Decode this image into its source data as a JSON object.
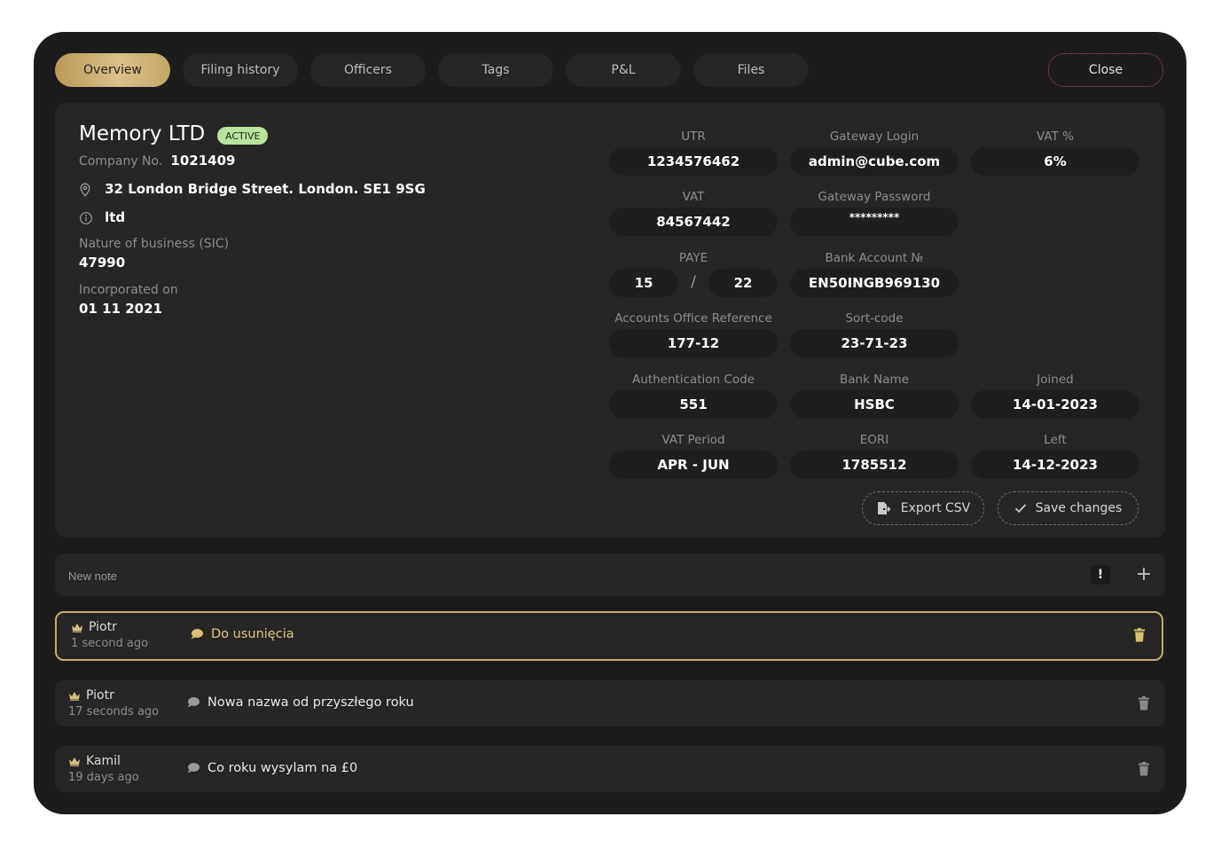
{
  "tabs": [
    {
      "label": "Overview",
      "active": true
    },
    {
      "label": "Filing history",
      "active": false
    },
    {
      "label": "Officers",
      "active": false
    },
    {
      "label": "Tags",
      "active": false
    },
    {
      "label": "P&L",
      "active": false
    },
    {
      "label": "Files",
      "active": false
    }
  ],
  "close_label": "Close",
  "company": {
    "name": "Memory LTD",
    "status": "ACTIVE",
    "number_label": "Company No.",
    "number": "1021409",
    "address": "32 London Bridge Street.  London. SE1 9SG",
    "type": "ltd",
    "sic_label": "Nature of business (SIC)",
    "sic": "47990",
    "incorporated_label": "Incorporated on",
    "incorporated": "01 11 2021"
  },
  "fields": {
    "utr": {
      "label": "UTR",
      "value": "1234576462"
    },
    "gateway_login": {
      "label": "Gateway Login",
      "value": "admin@cube.com"
    },
    "vat_percent": {
      "label": "VAT %",
      "value": "6%"
    },
    "vat": {
      "label": "VAT",
      "value": "84567442"
    },
    "gateway_password": {
      "label": "Gateway Password",
      "value": "*********"
    },
    "paye": {
      "label": "PAYE",
      "value_a": "15",
      "separator": "/",
      "value_b": "22"
    },
    "bank_account": {
      "label": "Bank Account №",
      "value": "EN50INGB969130"
    },
    "accounts_office_ref": {
      "label": "Accounts Office Reference",
      "value": "177-12"
    },
    "sort_code": {
      "label": "Sort-code",
      "value": "23-71-23"
    },
    "auth_code": {
      "label": "Authentication Code",
      "value": "551"
    },
    "bank_name": {
      "label": "Bank Name",
      "value": "HSBC"
    },
    "joined": {
      "label": "Joined",
      "value": "14-01-2023"
    },
    "vat_period": {
      "label": "VAT Period",
      "value": "APR - JUN"
    },
    "eori": {
      "label": "EORI",
      "value": "1785512"
    },
    "left": {
      "label": "Left",
      "value": "14-12-2023"
    }
  },
  "actions": {
    "export_label": "Export CSV",
    "save_label": "Save changes"
  },
  "note_input": {
    "placeholder": "New note",
    "important_label": "!",
    "add_label": "+"
  },
  "notes": [
    {
      "author": "Piotr",
      "time": "1 second ago",
      "text": "Do usunięcia",
      "highlight": true
    },
    {
      "author": "Piotr",
      "time": "17 seconds ago",
      "text": "Nowa nazwa od przyszłego roku",
      "highlight": false
    },
    {
      "author": "Kamil",
      "time": "19 days ago",
      "text": "Co roku wysylam na £0",
      "highlight": false
    }
  ],
  "colors": {
    "background": "#1c1c1c",
    "card": "#262626",
    "accent_gold": "#c4ac6b",
    "badge_green": "#b7e39a",
    "close_border": "#c0486a"
  },
  "icons": {
    "address": "map-pin-icon",
    "type": "info-icon",
    "export": "file-export-icon",
    "save": "check-icon",
    "author": "crown-icon",
    "note": "speech-bubble-icon",
    "delete": "trash-icon"
  }
}
